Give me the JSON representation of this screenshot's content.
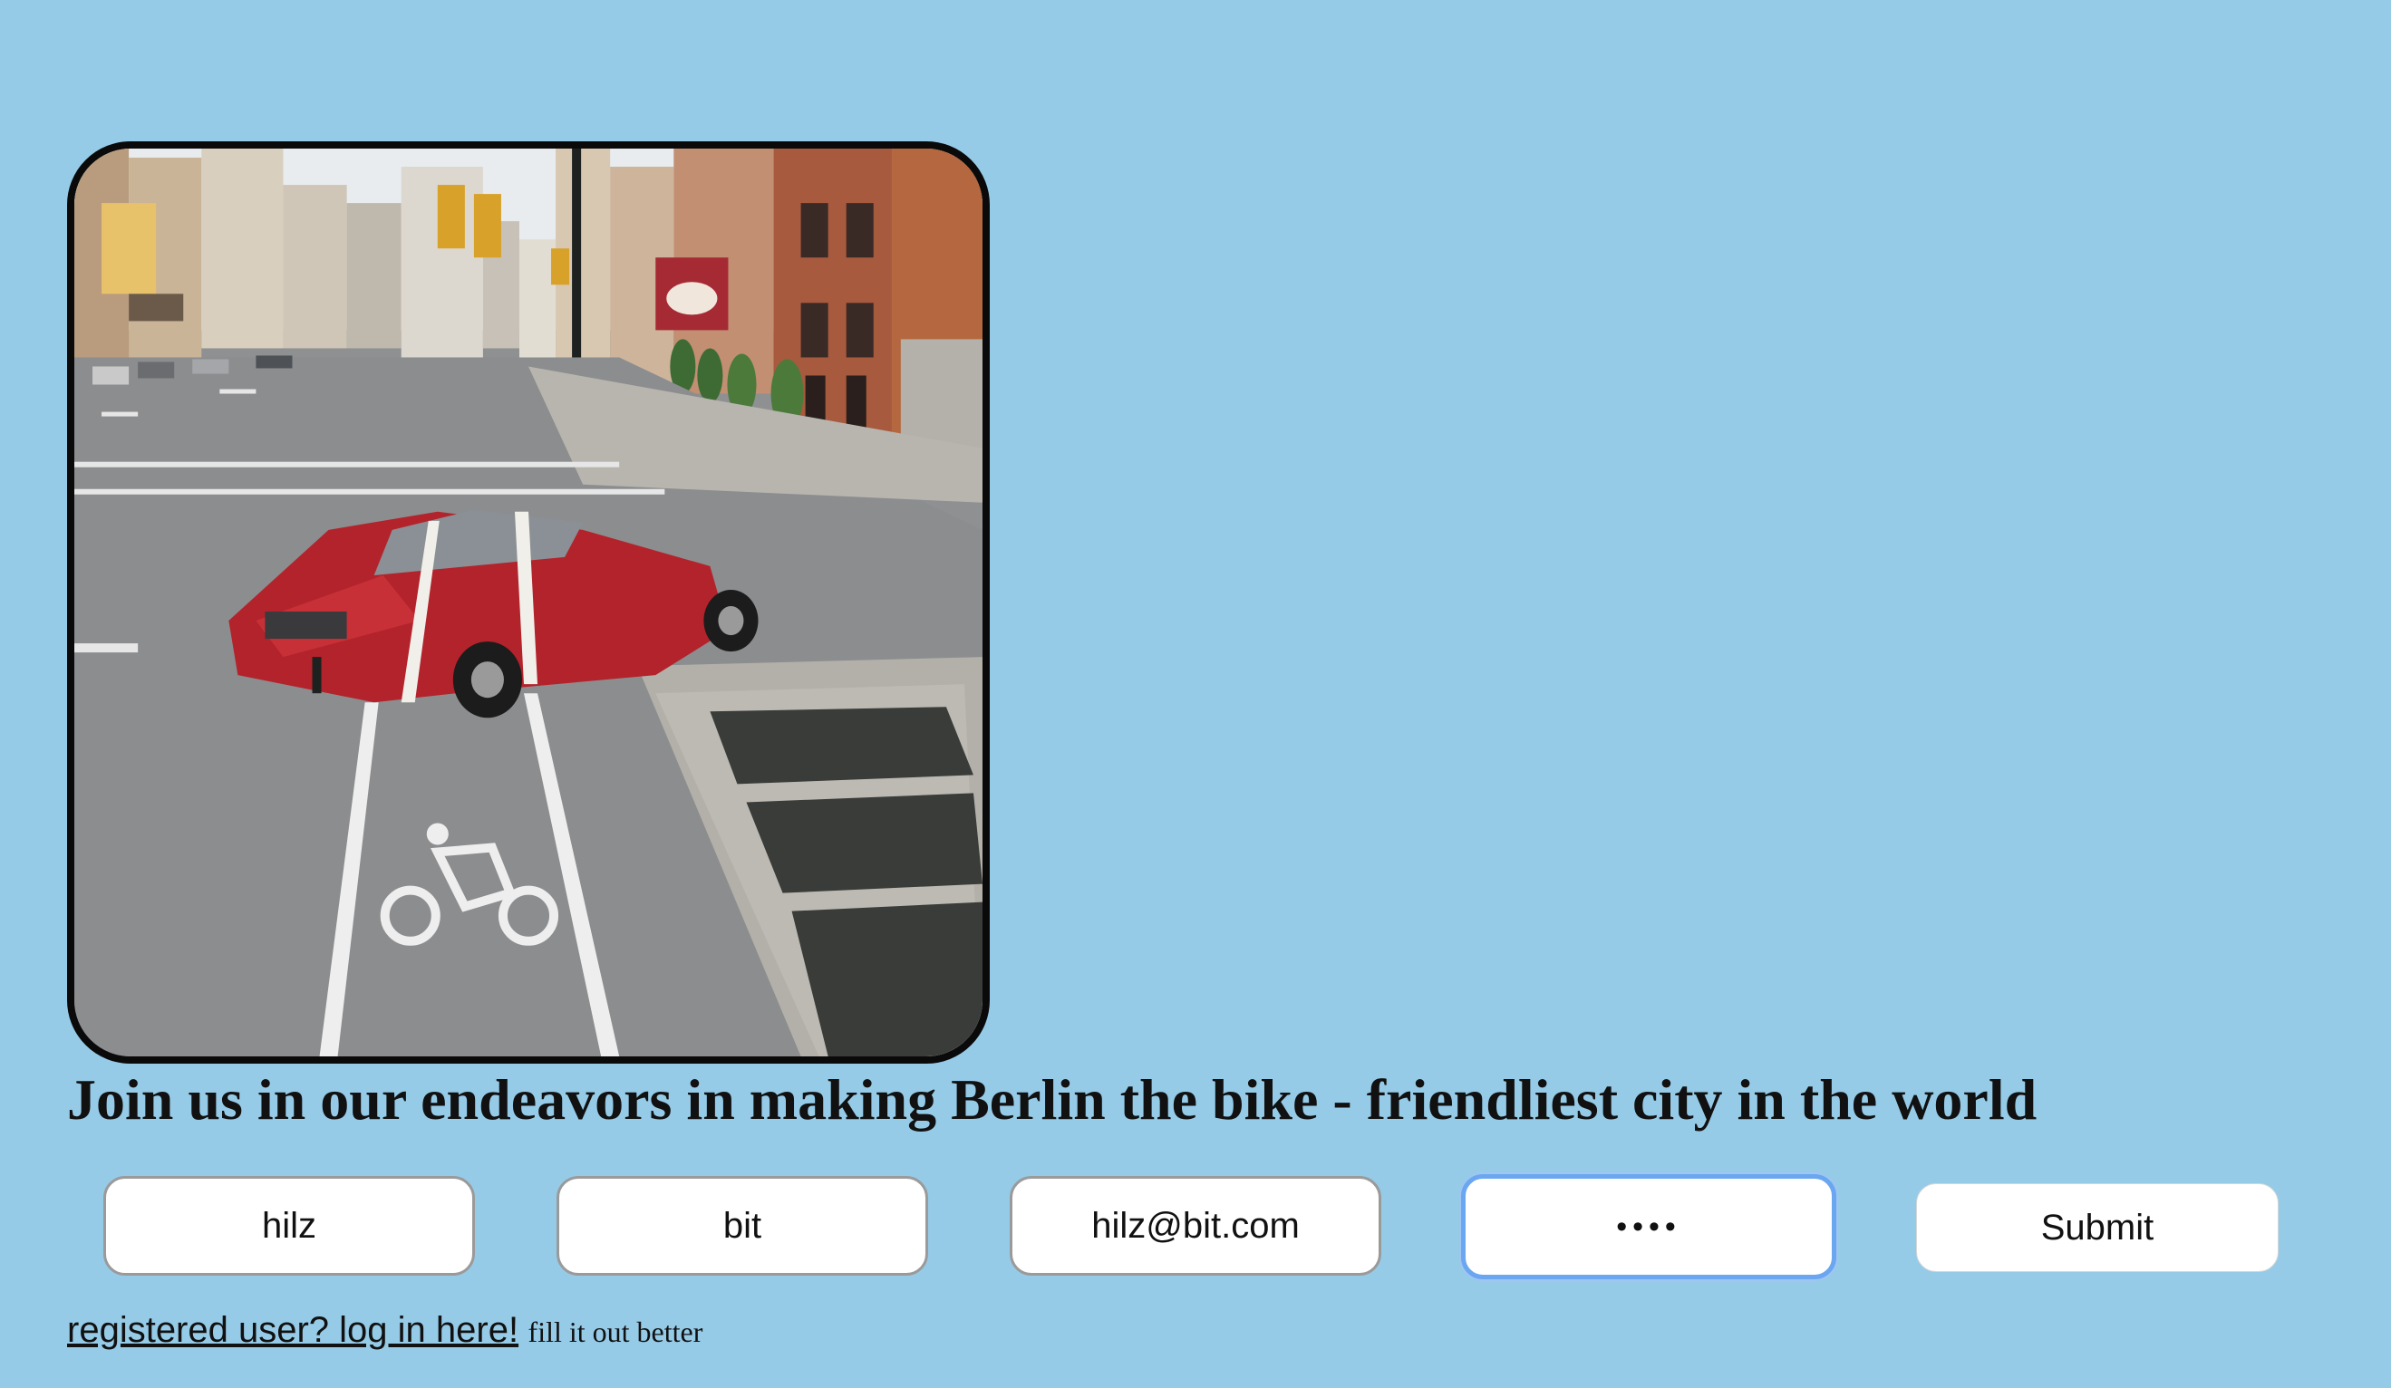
{
  "hero": {
    "image_description_icon": "street-photo-red-car-in-bike-lane"
  },
  "headline": "Join us in our endeavors in making Berlin the bike - friendliest city in the world",
  "form": {
    "first_name_value": "hilz",
    "last_name_value": "bit",
    "email_value": "hilz@bit.com",
    "password_value": "••••",
    "submit_label": "Submit"
  },
  "footer": {
    "login_link": "registered user? log in here!",
    "hint": "fill it out better"
  },
  "colors": {
    "background": "#96cbe8",
    "focus_ring": "#6aa7f0"
  }
}
